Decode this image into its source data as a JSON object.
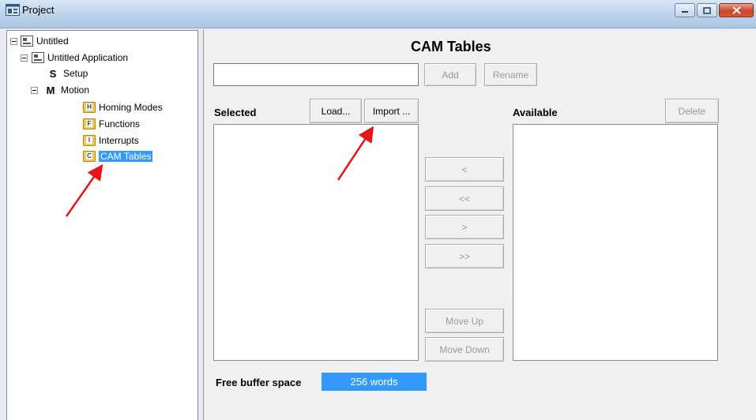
{
  "window": {
    "title": "Project",
    "minimize_glyph": "—",
    "maximize_glyph": "□",
    "close_glyph": "✕"
  },
  "tree": {
    "root_label": "Untitled",
    "application_label": "Untitled Application",
    "setup_letter": "S",
    "setup_label": "Setup",
    "motion_letter": "M",
    "motion_label": "Motion",
    "items": [
      {
        "label": "Homing Modes",
        "icon_letter": "H",
        "icon": "homing-folder-icon"
      },
      {
        "label": "Functions",
        "icon_letter": "F",
        "icon": "functions-folder-icon"
      },
      {
        "label": "Interrupts",
        "icon_letter": "I",
        "icon": "interrupts-folder-icon"
      },
      {
        "label": "CAM Tables",
        "icon_letter": "C",
        "icon": "cam-folder-icon",
        "selected": true
      }
    ]
  },
  "main": {
    "heading": "CAM Tables",
    "name_input_value": "",
    "add_label": "Add",
    "rename_label": "Rename",
    "selected_label": "Selected",
    "load_label": "Load...",
    "import_label": "Import ...",
    "available_label": "Available",
    "delete_label": "Delete",
    "move_left_label": "<",
    "move_all_left_label": "<<",
    "move_right_label": ">",
    "move_all_right_label": ">>",
    "move_up_label": "Move Up",
    "move_down_label": "Move Down",
    "free_buffer_label": "Free buffer space",
    "free_buffer_value": "256 words"
  },
  "colors": {
    "selection": "#3399ff",
    "annotation_arrow": "#e8141c"
  }
}
